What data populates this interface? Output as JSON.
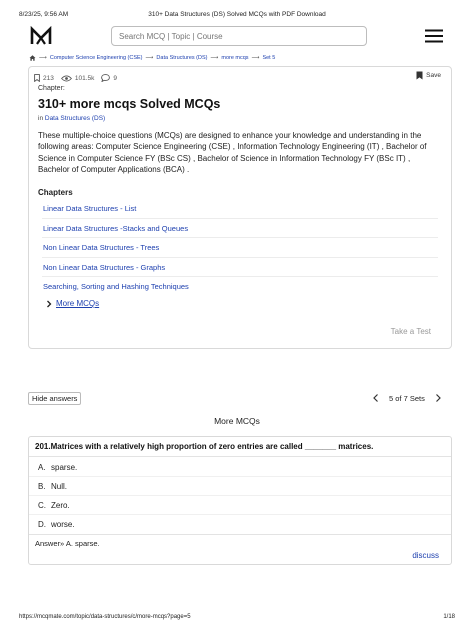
{
  "print_header": {
    "timestamp": "8/23/25, 9:56 AM",
    "page_title": "310+ Data Structures (DS) Solved MCQs with PDF Download"
  },
  "navbar": {
    "logo_icon": "mcqmate-logo-icon",
    "search_placeholder": "Search MCQ | Topic | Course",
    "menu_icon": "hamburger-menu-icon"
  },
  "breadcrumb": {
    "home_icon": "home-icon",
    "separator": "⟶",
    "items": [
      "Computer Science Engineering (CSE)",
      "Data Structures (DS)",
      "more mcqs",
      "Set 5"
    ]
  },
  "stats": {
    "bookmarks": "213",
    "views": "101.5k",
    "comments": "9"
  },
  "save_label": "Save",
  "chapter_label": "Chapter:",
  "title": "310+ more mcqs Solved MCQs",
  "in_label": "in",
  "in_link": "Data Structures (DS)",
  "description": "These multiple-choice questions (MCQs) are designed to enhance your knowledge and understanding in the following areas: Computer Science Engineering (CSE) , Information Technology Engineering (IT) , Bachelor of Science in Computer Science FY (BSc CS) , Bachelor of Science in Information Technology FY (BSc IT) , Bachelor of Computer Applications (BCA) .",
  "chapters_heading": "Chapters",
  "chapters": [
    "Linear Data Structures - List",
    "Linear Data Structures -Stacks and Queues",
    "Non Linear Data Structures - Trees",
    "Non Linear Data Structures - Graphs",
    "Searching, Sorting and Hashing Techniques"
  ],
  "more_mcqs_label": "More MCQs",
  "take_test_label": "Take a Test",
  "hide_answers_label": "Hide answers",
  "pager": {
    "label": "5 of 7 Sets"
  },
  "section_title": "More MCQs",
  "question": {
    "number": "201.",
    "text": "Matrices with a relatively high proportion of zero entries are called _______ matrices.",
    "options": [
      {
        "letter": "A.",
        "text": "sparse."
      },
      {
        "letter": "B.",
        "text": "Null."
      },
      {
        "letter": "C.",
        "text": "Zero."
      },
      {
        "letter": "D.",
        "text": "worse."
      }
    ],
    "answer": "Answer» A. sparse.",
    "discuss_label": "discuss"
  },
  "print_footer": {
    "url": "https://mcqmate.com/topic/data-structures/c/more-mcqs?page=5",
    "page": "1/18"
  },
  "colors": {
    "link": "#1e40af",
    "border": "#d9d9d9",
    "muted": "#999999"
  }
}
